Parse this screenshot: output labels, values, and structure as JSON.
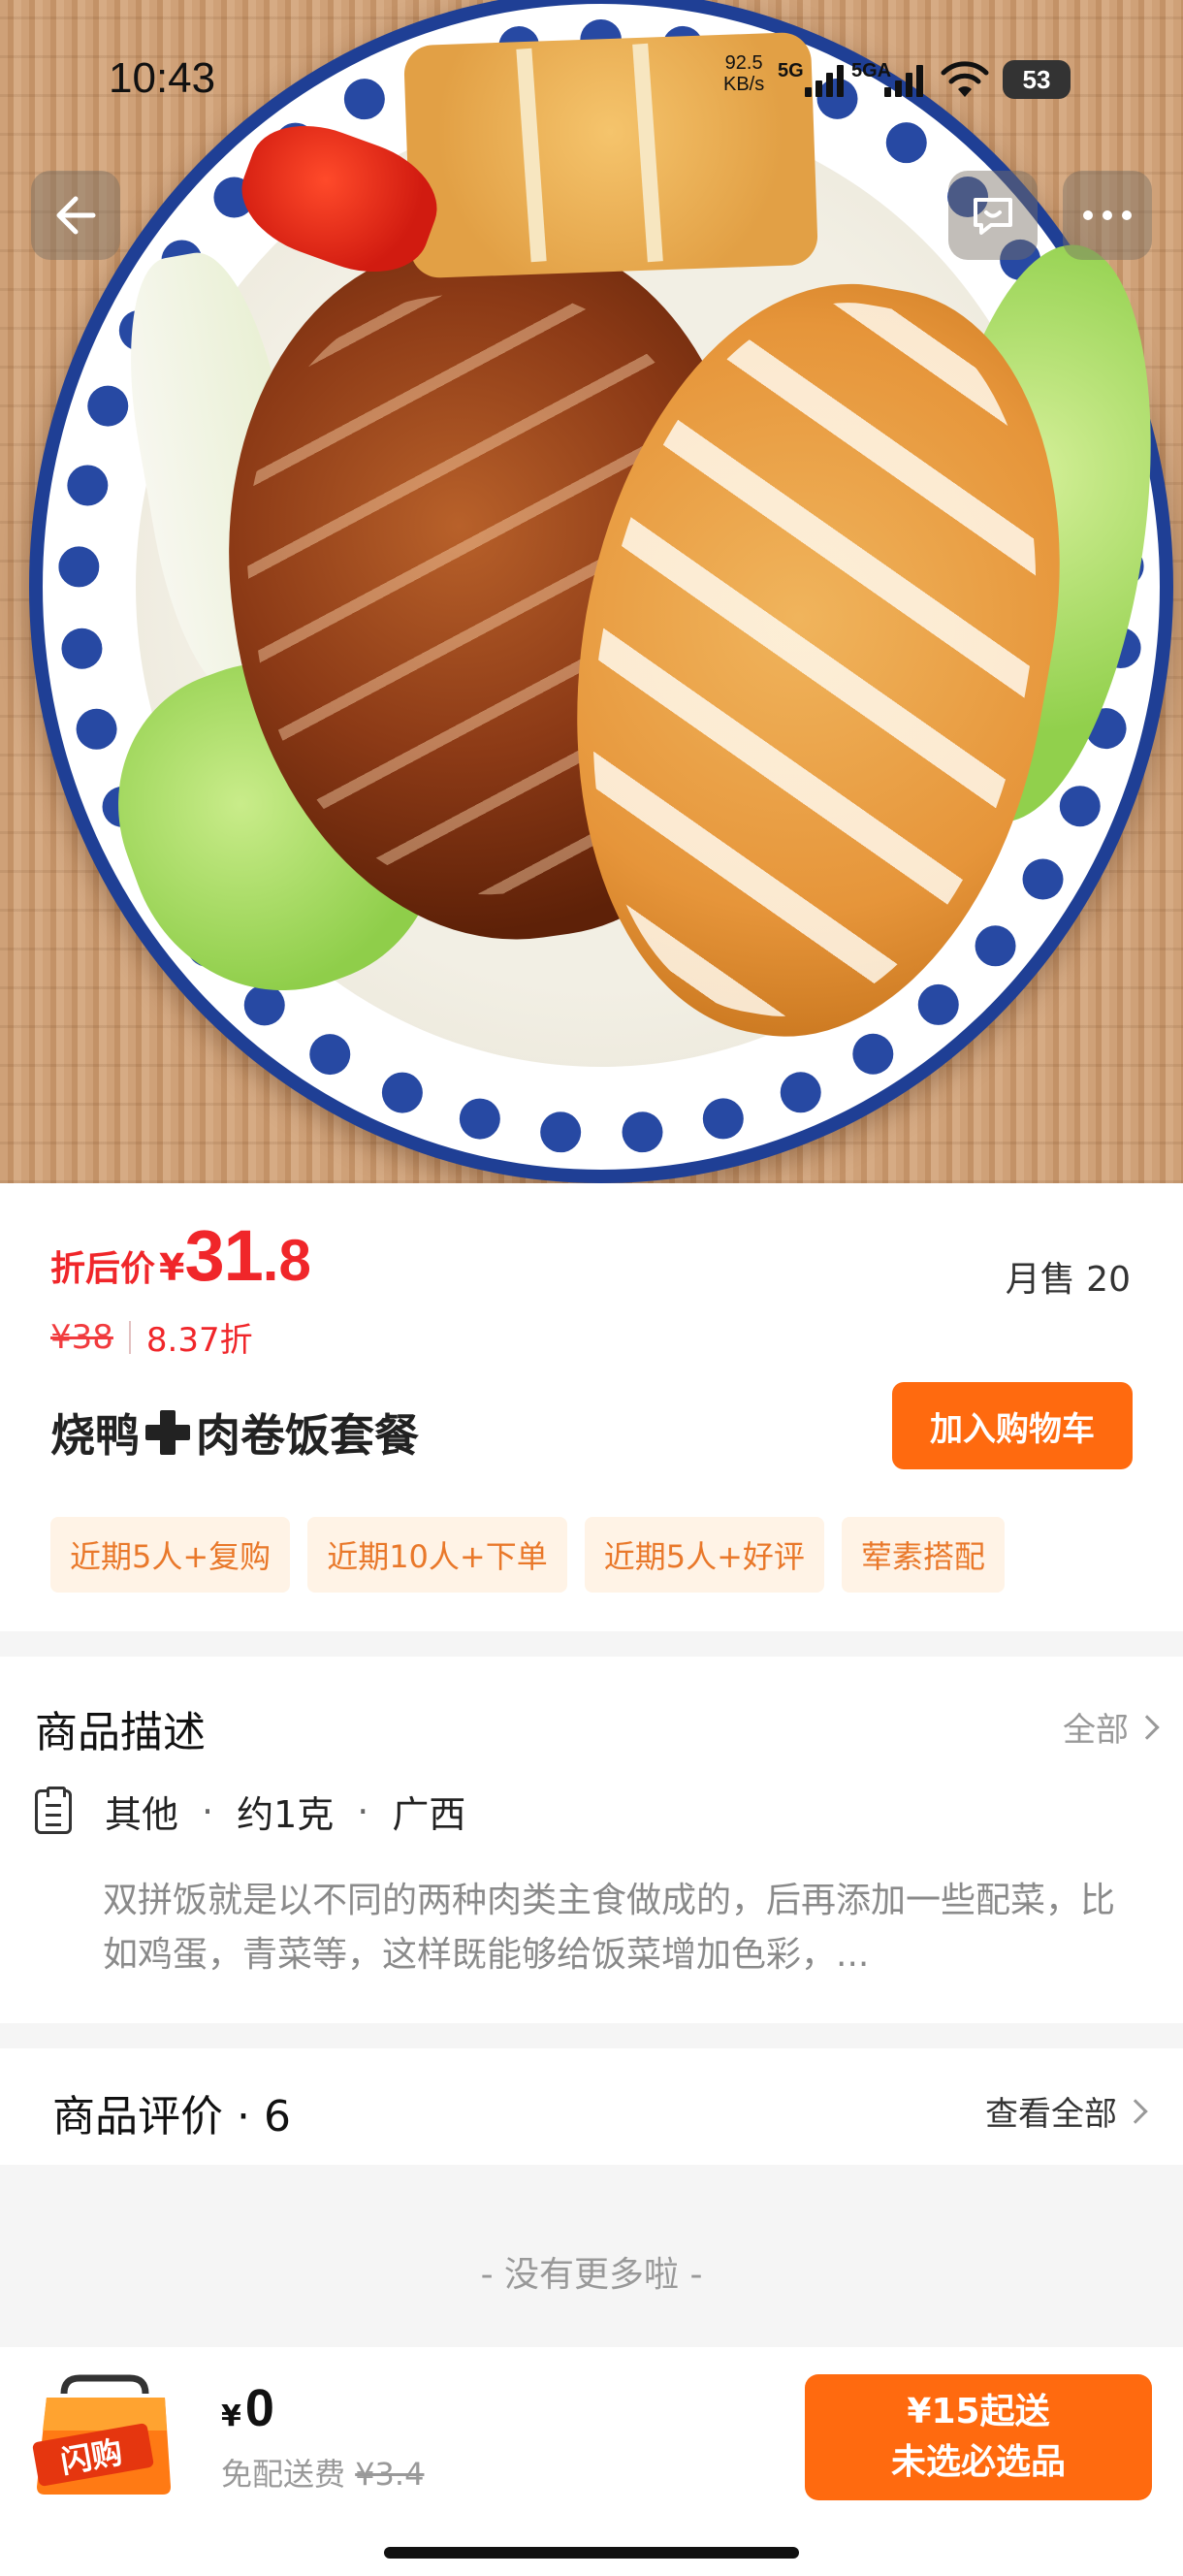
{
  "status_bar": {
    "time": "10:43",
    "net_speed_value": "92.5",
    "net_speed_unit": "KB/s",
    "sim1": "5G",
    "sim2": "5GA",
    "battery": "53"
  },
  "product": {
    "price_label": "折后价",
    "currency": "¥",
    "price_int": "31",
    "price_dec": ".8",
    "monthly_sales": "月售 20",
    "original_price": "¥38",
    "discount": "8.37折",
    "title_left": "烧鸭",
    "title_right": "肉卷饭套餐",
    "add_to_cart": "加入购物车",
    "tags": [
      "近期5人+复购",
      "近期10人+下单",
      "近期5人+好评",
      "荤素搭配"
    ]
  },
  "description": {
    "title": "商品描述",
    "all_label": "全部",
    "spec": [
      "其他",
      "约1克",
      "广西"
    ],
    "spec_separator": "·",
    "text": "双拼饭就是以不同的两种肉类主食做成的，后再添加一些配菜，比如鸡蛋，青菜等，这样既能够给饭菜增加色彩，..."
  },
  "reviews": {
    "title": "商品评价 · 6",
    "view_all": "查看全部",
    "no_more": "- 没有更多啦 -"
  },
  "bottom_bar": {
    "bag_text": "闪购",
    "currency": "¥",
    "total": "0",
    "delivery_label": "免配送费",
    "delivery_old": "¥3.4",
    "checkout_line1": "¥15起送",
    "checkout_line2": "未选必选品"
  },
  "colors": {
    "accent": "#ff6a0f",
    "price_red": "#f0262a",
    "tag_bg": "#fff3e6",
    "tag_text": "#e9782a"
  }
}
